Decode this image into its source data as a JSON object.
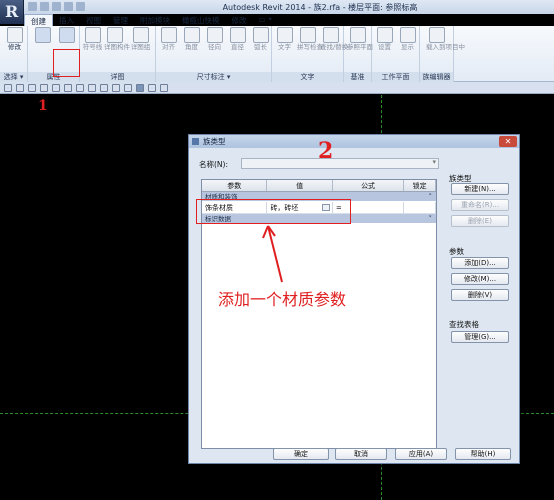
{
  "window": {
    "title": "Autodesk Revit 2014 -    族2.rfa - 楼层平面: 参照标高",
    "app_icon": "R"
  },
  "ribbon": {
    "tabs": [
      "创建",
      "插入",
      "视图",
      "管理",
      "附加模块",
      "橄榄山快模",
      "修改",
      "▭ •"
    ],
    "active_tab": "创建",
    "buttons": {
      "modify": "修改",
      "family_types": "",
      "family_category": "",
      "detail_line": "符号线",
      "detail_component": "详图构件",
      "detail_group": "详图组",
      "aligned": "对齐",
      "angular": "角度",
      "radial": "径向",
      "diameter": "直径",
      "arc_length": "弧长",
      "text": "文字",
      "spelling": "拼写检查",
      "find_replace": "查找/替换",
      "datum": "参照平面",
      "set": "设置",
      "show": "显示",
      "load_into_project": "载入到项目中"
    },
    "groups": {
      "select": "选择 ▾",
      "properties": "属性",
      "detail": "详图",
      "dimension": "尺寸标注 ▾",
      "text": "文字",
      "datum": "基准",
      "work_plane": "工作平面",
      "family_editor": "族编辑器"
    }
  },
  "dialog": {
    "title": "族类型",
    "close_label": "✕",
    "name_label": "名称(N):",
    "name_value": "",
    "columns": [
      "参数",
      "值",
      "公式",
      "锁定"
    ],
    "groups": [
      {
        "label": "材质和装饰",
        "rows": [
          {
            "param": "饰条材质",
            "value": "砖，砖坯",
            "formula": "=",
            "locked": ""
          }
        ]
      },
      {
        "label": "标识数据",
        "rows": []
      }
    ],
    "family_types_header": "族类型",
    "family_buttons": {
      "new": "新建(N)...",
      "rename": "重命名(R)...",
      "delete": "删除(E)"
    },
    "parameters_header": "参数",
    "param_buttons": {
      "add": "添加(D)...",
      "modify": "修改(M)...",
      "remove": "删除(V)"
    },
    "lookup_header": "查找表格",
    "lookup_button": "管理(G)...",
    "footer": {
      "ok": "确定",
      "cancel": "取消",
      "apply": "应用(A)",
      "help": "帮助(H)"
    }
  },
  "annotations": {
    "step1": "1",
    "step2": "2",
    "note": "添加一个材质参数",
    "color": "#e02020"
  }
}
